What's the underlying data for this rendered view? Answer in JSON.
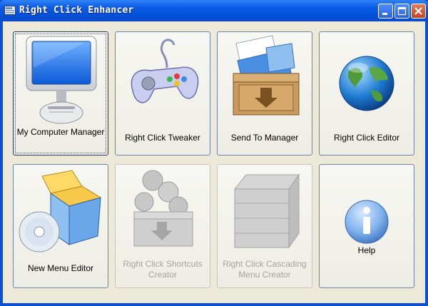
{
  "window": {
    "title": "Right Click Enhancer"
  },
  "tiles": [
    {
      "label": "My Computer Manager",
      "icon": "monitor-icon",
      "enabled": true,
      "focused": true
    },
    {
      "label": "Right Click Tweaker",
      "icon": "gamepad-icon",
      "enabled": true
    },
    {
      "label": "Send To Manager",
      "icon": "crate-with-folder-icon",
      "enabled": true
    },
    {
      "label": "Right Click Editor",
      "icon": "globe-icon",
      "enabled": true
    },
    {
      "label": "New Menu Editor",
      "icon": "box-with-cd-icon",
      "enabled": true
    },
    {
      "label": "Right Click Shortcuts Creator",
      "icon": "crate-with-shortcuts-icon",
      "enabled": false
    },
    {
      "label": "Right Click Cascading Menu Creator",
      "icon": "crate-icon",
      "enabled": false
    },
    {
      "label": "Help",
      "icon": "info-icon",
      "enabled": true
    }
  ]
}
